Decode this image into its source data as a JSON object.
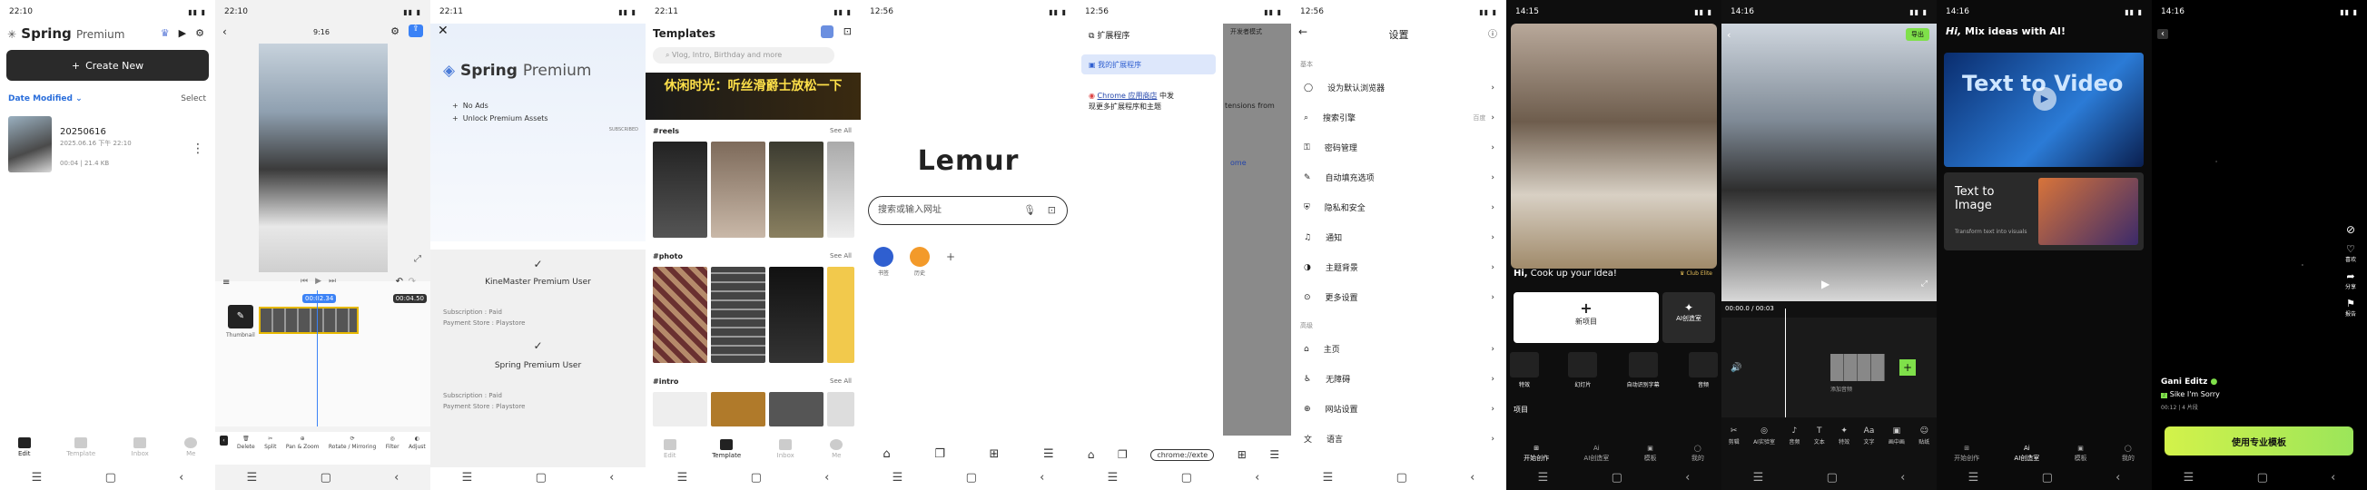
{
  "s1": {
    "time": "22:10",
    "brand": "Spring",
    "brand2": "Premium",
    "create": "Create New",
    "sort": "Date Modified",
    "select": "Select",
    "project": {
      "name": "20250616",
      "date": "2025.06.16   下午 22:10",
      "meta": "00:04   |   21.4 KB"
    },
    "tabs": [
      "Edit",
      "Template",
      "Inbox",
      "Me"
    ]
  },
  "s2": {
    "time": "22:10",
    "ratio": "9:16",
    "timecode": "00:02.34",
    "duration": "00:04.50",
    "tools": [
      "Delete",
      "Split",
      "Pan & Zoom",
      "Rotate / Mirroring",
      "Filter",
      "Adjust"
    ],
    "thumb_label": "Thumbnail"
  },
  "s3": {
    "time": "22:11",
    "brand": "Spring",
    "brand2": "Premium",
    "features": [
      "No Ads",
      "Unlock Premium Assets"
    ],
    "sub_label": "SUBSCRIBED",
    "user1": "KineMaster Premium User",
    "user2": "Spring Premium User",
    "sub_paid": "Subscription : Paid",
    "store": "Payment Store : Playstore"
  },
  "s4": {
    "time": "22:11",
    "title": "Templates",
    "search": "Vlog, Intro, Birthday and more",
    "banner": "休闲时光：听丝滑爵士放松一下",
    "sections": [
      "#reels",
      "#photo",
      "#intro"
    ],
    "see_all": "See All",
    "tabs": [
      "Edit",
      "Template",
      "Inbox",
      "Me"
    ]
  },
  "s5": {
    "time": "12:56",
    "logo": "Lemur",
    "search": "搜索或输入网址",
    "shortcuts": [
      "书签",
      "历史"
    ]
  },
  "s6": {
    "time": "12:56",
    "title": "扩展程序",
    "item1": "我的扩展程序",
    "link": "Chrome 应用商店",
    "line1": "中发",
    "line2": "现更多扩展程序和主题",
    "behind_title": "开发者模式",
    "behind1": "tensions from",
    "behind2": "ome",
    "url": "chrome://exte"
  },
  "s7": {
    "time": "12:56",
    "title": "设置",
    "cap1": "基本",
    "cap2": "高级",
    "basic": [
      {
        "label": "设为默认浏览器",
        "value": ""
      },
      {
        "label": "搜索引擎",
        "value": "百度"
      },
      {
        "label": "密码管理",
        "value": ""
      },
      {
        "label": "自动填充选项",
        "value": ""
      },
      {
        "label": "隐私和安全",
        "value": ""
      },
      {
        "label": "通知",
        "value": ""
      },
      {
        "label": "主题背景",
        "value": ""
      },
      {
        "label": "更多设置",
        "value": ""
      }
    ],
    "advanced": [
      "主页",
      "无障碍",
      "网站设置",
      "语言"
    ]
  },
  "s8": {
    "time": "14:15",
    "cook": "Cook up your idea!",
    "club": "Club Elite",
    "new_project": "新项目",
    "ai_creation": "AI创造室",
    "tools": [
      "特效",
      "幻灯片",
      "自动识别字幕",
      "音频"
    ],
    "projects": "项目",
    "tabs": [
      "开始创作",
      "AI创造室",
      "模板",
      "我的"
    ]
  },
  "s9": {
    "time": "14:16",
    "export": "导出",
    "timecode": "00:00.0 / 00:03",
    "add_sound": "添加音频",
    "tools": [
      "剪辑",
      "AI实验室",
      "音频",
      "文本",
      "特效",
      "文字",
      "画中画",
      "贴纸"
    ]
  },
  "s10": {
    "time": "14:16",
    "header": "Mix ideas with AI!",
    "card1": "Text to Video",
    "card2_title": "Text to Image",
    "card2_desc": "Transform text into visuals",
    "tabs": [
      "开始创作",
      "AI创造室",
      "模板",
      "我的"
    ]
  },
  "s11": {
    "time": "14:16",
    "actions": [
      "喜欢",
      "分享",
      "报告"
    ],
    "user": "Gani Editz",
    "song": "Sike I'm Sorry",
    "meta": "00:12 | 4 片段",
    "cta": "使用专业模板"
  }
}
